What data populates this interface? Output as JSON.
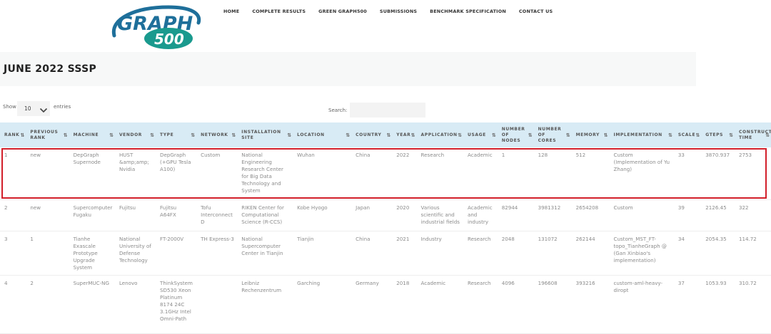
{
  "logo": {
    "word": "GRAPH",
    "number": "500"
  },
  "nav": [
    "HOME",
    "COMPLETE RESULTS",
    "GREEN GRAPH500",
    "SUBMISSIONS",
    "BENCHMARK SPECIFICATION",
    "CONTACT US"
  ],
  "page_title": "JUNE 2022 SSSP",
  "controls": {
    "show_label": "Show",
    "entries_value": "10",
    "entries_label": "entries",
    "search_label": "Search:",
    "search_value": ""
  },
  "table": {
    "columns": [
      "RANK",
      "PREVIOUS RANK",
      "MACHINE",
      "VENDOR",
      "TYPE",
      "NETWORK",
      "INSTALLATION SITE",
      "LOCATION",
      "COUNTRY",
      "YEAR",
      "APPLICATION",
      "USAGE",
      "NUMBER OF NODES",
      "NUMBER OF CORES",
      "MEMORY",
      "IMPLEMENTATION",
      "SCALE",
      "GTEPS",
      "CONSTRUCTION TIME"
    ],
    "rows": [
      [
        "1",
        "new",
        "DepGraph Supernode",
        "HUST &amp;amp; Nvidia",
        "DepGraph (+GPU Tesla A100)",
        "Custom",
        "National Engineering Research Center for Big Data Technology and System",
        "Wuhan",
        "China",
        "2022",
        "Research",
        "Academic",
        "1",
        "128",
        "512",
        "Custom (Implementation of Yu Zhang)",
        "33",
        "3870.937",
        "2753"
      ],
      [
        "2",
        "new",
        "Supercomputer Fugaku",
        "Fujitsu",
        "Fujitsu A64FX",
        "Tofu Interconnect D",
        "RIKEN Center for Computational Science (R-CCS)",
        "Kobe Hyogo",
        "Japan",
        "2020",
        "Various scientific and industrial fields",
        "Academic and industry",
        "82944",
        "3981312",
        "2654208",
        "Custom",
        "39",
        "2126.45",
        "322"
      ],
      [
        "3",
        "1",
        "Tianhe Exascale Prototype Upgrade System",
        "National University of Defense Technology",
        "FT-2000V",
        "TH Express-3",
        "National Supercomputer Center in Tianjin",
        "Tianjin",
        "China",
        "2021",
        "Industry",
        "Research",
        "2048",
        "131072",
        "262144",
        "Custom_MST_FT-topo_TianheGraph @ (Gan Xinbiao's implementation)",
        "34",
        "2054.35",
        "114.72"
      ],
      [
        "4",
        "2",
        "SuperMUC-NG",
        "Lenovo",
        "ThinkSystem SD530 Xeon Platinum 8174 24C 3.1GHz Intel Omni-Path",
        "",
        "Leibniz Rechenzentrum",
        "Garching",
        "Germany",
        "2018",
        "Academic",
        "Research",
        "4096",
        "196608",
        "393216",
        "custom-aml-heavy-diropt",
        "37",
        "1053.93",
        "310.72"
      ]
    ]
  },
  "colors": {
    "header_bg": "#d8ebf5",
    "highlight_border": "#d21f2a",
    "logo_blue": "#1e6f9a",
    "logo_teal": "#1a9a8e"
  },
  "highlighted_row_rank": "1",
  "sort_icon": "sort-arrows-icon",
  "dropdown_icon": "chevron-down-icon"
}
